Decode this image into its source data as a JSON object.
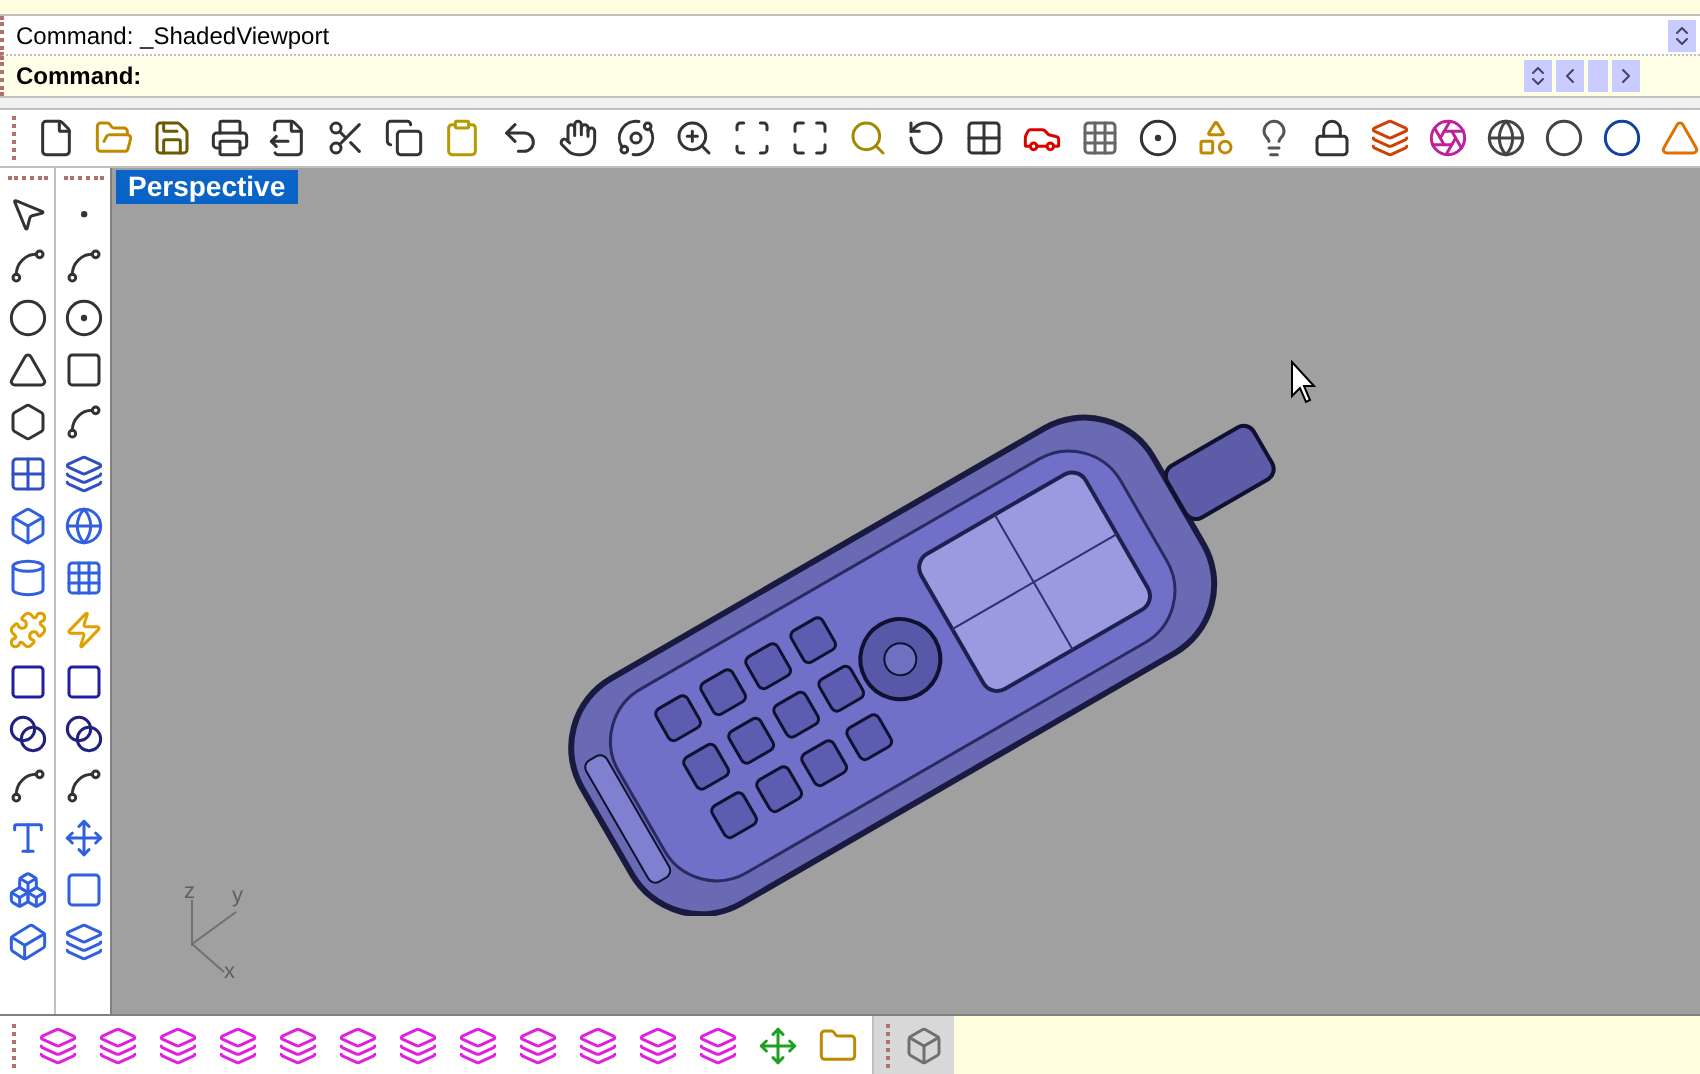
{
  "command_history": "Command: _ShadedViewport",
  "command_prompt": "Command:",
  "viewport": {
    "title": "Perspective",
    "axes": {
      "z": "z",
      "y": "y",
      "x": "x"
    }
  }
}
